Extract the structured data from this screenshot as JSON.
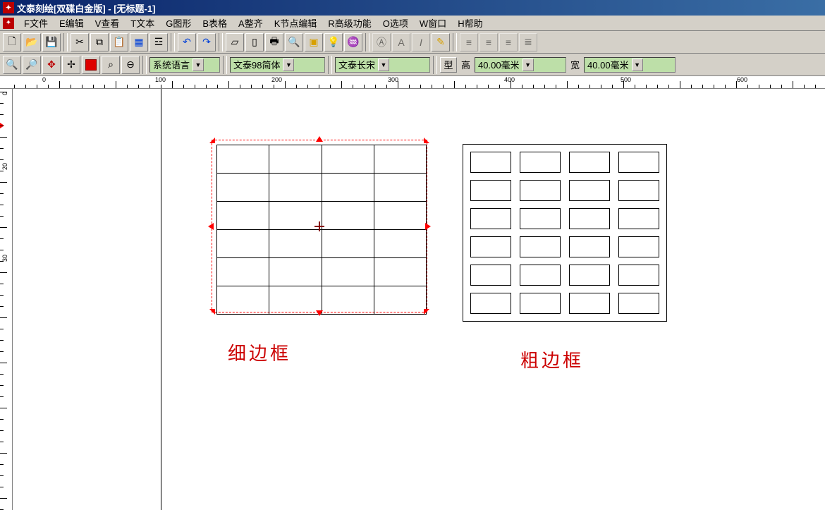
{
  "title": "文泰刻绘[双碟白金版] - [无标题-1]",
  "menu": {
    "file": "F文件",
    "edit": "E编辑",
    "view": "V查看",
    "text": "T文本",
    "graphic": "G图形",
    "table": "B表格",
    "arrange": "A整齐",
    "node": "K节点编辑",
    "advanced": "R高级功能",
    "options": "O选项",
    "window": "W窗口",
    "help": "H帮助"
  },
  "toolbar2": {
    "lang": "系统语言",
    "font1": "文泰98简体",
    "font2": "文泰长宋",
    "style_btn": "型",
    "height_label": "高",
    "height_value": "40.00毫米",
    "width_label": "宽",
    "width_value": "40.00毫米"
  },
  "ruler_h": [
    "0",
    "100",
    "200",
    "300",
    "400",
    "500",
    "600"
  ],
  "ruler_v": [
    "0",
    "20",
    "30"
  ],
  "canvas_labels": {
    "thin_border": "细边框",
    "thick_border": "粗边框"
  }
}
